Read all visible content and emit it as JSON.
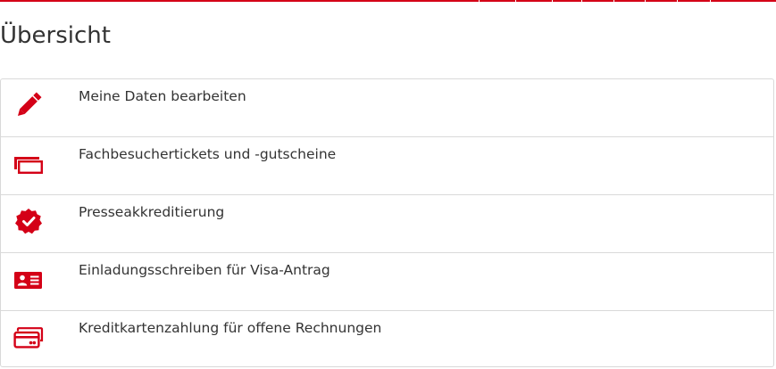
{
  "page": {
    "title": "Übersicht"
  },
  "colors": {
    "accent": "#d40017",
    "text": "#333333",
    "border": "#d9d9d9"
  },
  "menu": {
    "items": [
      {
        "label": "Meine Daten bearbeiten",
        "icon": "pencil-icon"
      },
      {
        "label": "Fachbesuchertickets und -gutscheine",
        "icon": "tickets-icon"
      },
      {
        "label": "Presseakkreditierung",
        "icon": "verified-badge-icon"
      },
      {
        "label": "Einladungsschreiben für Visa-Antrag",
        "icon": "id-card-icon"
      },
      {
        "label": "Kreditkartenzahlung für offene Rechnungen",
        "icon": "credit-card-icon"
      }
    ]
  }
}
